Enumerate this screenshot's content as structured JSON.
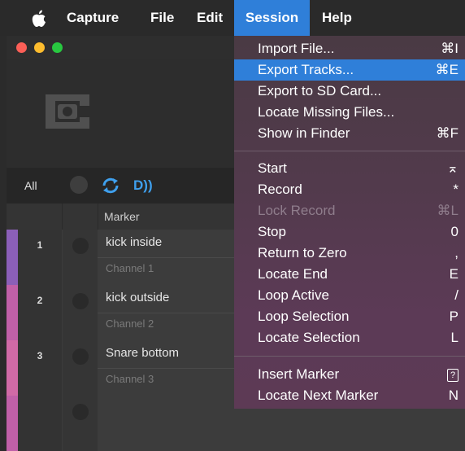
{
  "menubar": {
    "apple_icon": "apple-logo-icon",
    "items": [
      "Capture",
      "File",
      "Edit",
      "Session",
      "Help"
    ]
  },
  "window": {
    "toolbar": {
      "all_label": "All",
      "loop_icon": "loop-icon",
      "d_icon_label": "D))"
    },
    "column_header": {
      "marker": "Marker"
    },
    "rows": [
      {
        "num": "1",
        "name": "kick inside",
        "channel": "Channel 1",
        "color": "#8b5fb8"
      },
      {
        "num": "2",
        "name": "kick outside",
        "channel": "Channel 2",
        "color": "#c060a8"
      },
      {
        "num": "3",
        "name": "Snare bottom",
        "channel": "Channel 3",
        "color": "#d06aa6"
      }
    ]
  },
  "session_menu": {
    "items": [
      {
        "label": "Import File...",
        "shortcut": "⌘I"
      },
      {
        "label": "Export Tracks...",
        "shortcut": "⌘E",
        "selected": true
      },
      {
        "label": "Export to SD Card...",
        "shortcut": ""
      },
      {
        "label": "Locate Missing Files...",
        "shortcut": ""
      },
      {
        "label": "Show in Finder",
        "shortcut": "⌘F"
      },
      {
        "label": "Start",
        "shortcut": "⌅"
      },
      {
        "label": "Record",
        "shortcut": "*"
      },
      {
        "label": "Lock Record",
        "shortcut": "⌘L",
        "disabled": true
      },
      {
        "label": "Stop",
        "shortcut": "0"
      },
      {
        "label": "Return to Zero",
        "shortcut": ","
      },
      {
        "label": "Locate End",
        "shortcut": "E"
      },
      {
        "label": "Loop Active",
        "shortcut": "/"
      },
      {
        "label": "Loop Selection",
        "shortcut": "P"
      },
      {
        "label": "Locate Selection",
        "shortcut": "L"
      },
      {
        "label": "Insert Marker",
        "shortcut": "?"
      },
      {
        "label": "Locate Next Marker",
        "shortcut": "N"
      }
    ]
  },
  "colors": {
    "accent": "#2f7fd9",
    "menu_bg": "#553a4e"
  }
}
